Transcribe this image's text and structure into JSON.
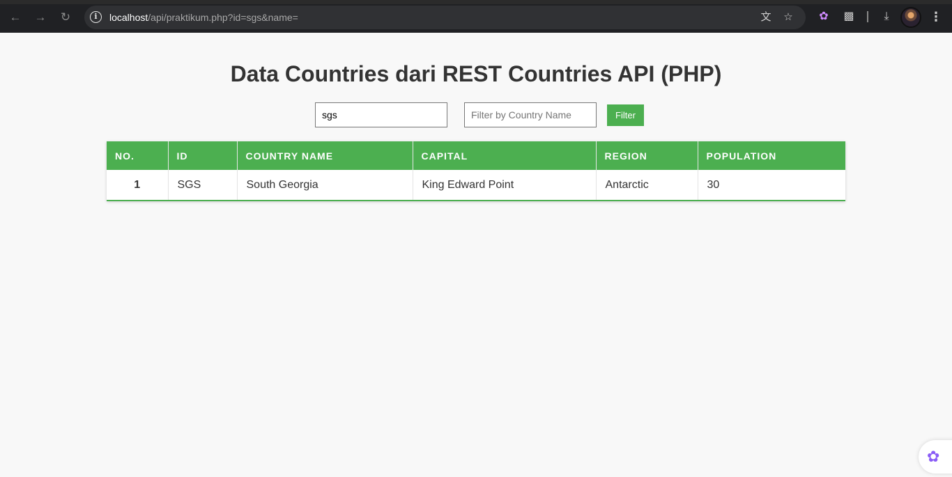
{
  "browser": {
    "url_host": "localhost",
    "url_path": "/api/praktikum.php?id=sgs&name=",
    "icons": [
      "back-arrow-icon",
      "forward-arrow-icon",
      "reload-icon",
      "site-info-icon",
      "translate-icon",
      "bookmark-star-icon",
      "brain-extension-icon",
      "puzzle-extensions-icon",
      "download-icon",
      "profile-avatar",
      "kebab-menu-icon"
    ]
  },
  "page": {
    "title": "Data Countries dari REST Countries API (PHP)",
    "id_input_value": "sgs",
    "name_input_placeholder": "Filter by Country Name",
    "name_input_value": "",
    "filter_button_label": "Filter"
  },
  "table": {
    "headers": [
      "NO.",
      "ID",
      "COUNTRY NAME",
      "CAPITAL",
      "REGION",
      "POPULATION"
    ],
    "rows": [
      {
        "no": "1",
        "id": "SGS",
        "name": "South Georgia",
        "capital": "King Edward Point",
        "region": "Antarctic",
        "population": "30"
      }
    ]
  },
  "colors": {
    "accent": "#4caf50",
    "page_background": "#f8f8f8",
    "browser_chrome": "#202124"
  }
}
